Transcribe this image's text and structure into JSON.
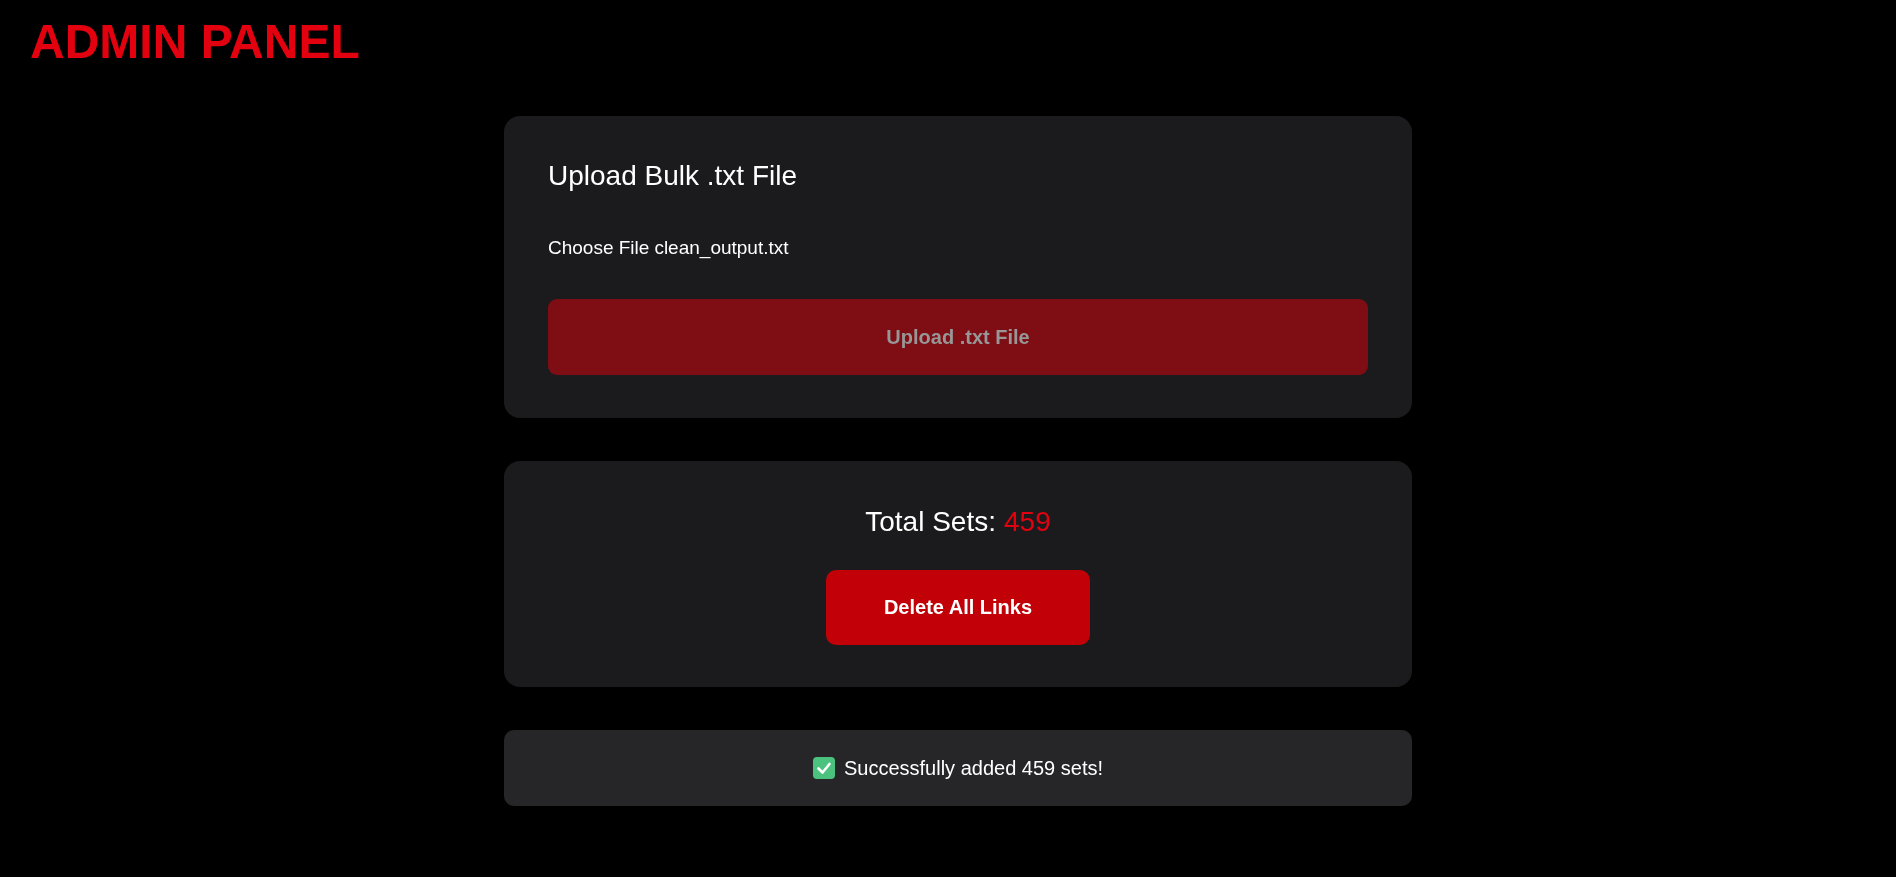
{
  "header": {
    "title": "ADMIN PANEL"
  },
  "upload_card": {
    "heading": "Upload Bulk .txt File",
    "file_input": {
      "button_label": "Choose File",
      "file_name": "clean_output.txt"
    },
    "upload_button": {
      "label": "Upload .txt File",
      "disabled": true
    }
  },
  "stats_card": {
    "label": "Total Sets:",
    "count": "459",
    "delete_button": {
      "label": "Delete All Links"
    }
  },
  "status_message": {
    "kind": "success",
    "text": "Successfully added 459 sets!"
  }
}
